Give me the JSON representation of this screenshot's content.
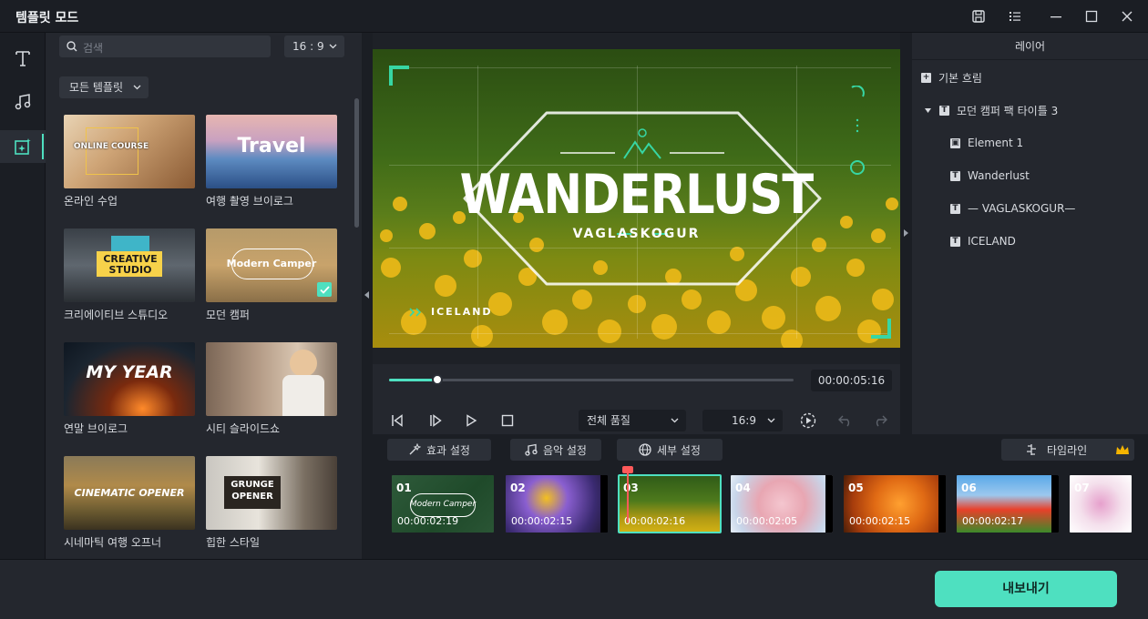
{
  "window": {
    "title": "템플릿 모드"
  },
  "search": {
    "placeholder": "검색"
  },
  "ratio_select": {
    "value": "16 : 9"
  },
  "filter": {
    "value": "모든 템플릿"
  },
  "templates": [
    {
      "label": "온라인 수업",
      "thumb_text": "ONLINE COURSE"
    },
    {
      "label": "여행 촬영 브이로그",
      "thumb_text": "Travel"
    },
    {
      "label": "크리에이티브 스튜디오",
      "thumb_text": "CREATIVE STUDIO"
    },
    {
      "label": "모던 캠퍼",
      "thumb_text": "Modern Camper"
    },
    {
      "label": "연말 브이로그",
      "thumb_text": "MY YEAR"
    },
    {
      "label": "시티 슬라이드쇼",
      "thumb_text": ""
    },
    {
      "label": "시네마틱 여행 오프너",
      "thumb_text": "CINEMATIC OPENER"
    },
    {
      "label": "힙한 스타일",
      "thumb_text": "GRUNGE OPENER"
    }
  ],
  "preview": {
    "title": "WANDERLUST",
    "subtitle": "VAGLASKOGUR",
    "tag": "ICELAND",
    "progress": 0.12
  },
  "transport": {
    "time": "00:00:05:16",
    "quality": "전체 품질",
    "ratio": "16:9"
  },
  "layers": {
    "header": "레이어",
    "items": [
      {
        "label": "기본 흐림"
      },
      {
        "label": "모던 캠퍼 팩 타이틀 3"
      },
      {
        "label": "Element 1"
      },
      {
        "label": "Wanderlust"
      },
      {
        "label": "— VAGLASKOGUR—"
      },
      {
        "label": "ICELAND"
      }
    ]
  },
  "tools": {
    "effects": "효과 설정",
    "music": "음악 설정",
    "details": "세부 설정",
    "timeline": "타임라인"
  },
  "clips": [
    {
      "num": "01",
      "dur": "00:00:02:19",
      "inner": "Modern Camper"
    },
    {
      "num": "02",
      "dur": "00:00:02:15"
    },
    {
      "num": "03",
      "dur": "00:00:02:16"
    },
    {
      "num": "04",
      "dur": "00:00:02:05"
    },
    {
      "num": "05",
      "dur": "00:00:02:15"
    },
    {
      "num": "06",
      "dur": "00:00:02:17"
    },
    {
      "num": "07",
      "dur": ""
    }
  ],
  "export": {
    "label": "내보내기"
  },
  "colors": {
    "accent": "#4ee0c0",
    "playhead": "#ff5a5a",
    "crown": "#f5b400"
  }
}
